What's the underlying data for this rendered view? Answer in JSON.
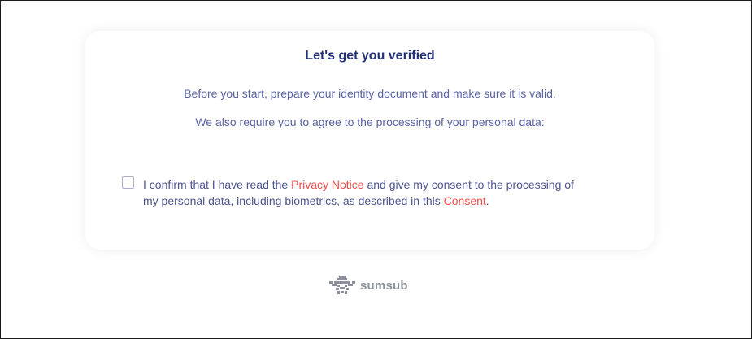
{
  "card": {
    "title": "Let's get you verified",
    "paragraph_1": "Before you start, prepare your identity document and make sure it is valid.",
    "paragraph_2": "We also require you to agree to the processing of your personal data:"
  },
  "consent": {
    "checked": false,
    "text_before_privacy": "I confirm that I have read the ",
    "privacy_link": "Privacy Notice",
    "text_middle": " and give my consent to the processing of my personal data, including biometrics, as described in this ",
    "consent_link": "Consent",
    "text_end": "."
  },
  "brand": {
    "name": "sumsub",
    "icon": "sumsub-logo-icon"
  },
  "colors": {
    "title": "#23307a",
    "body_text": "#5a63a6",
    "link": "#ef4c4c",
    "checkbox_border": "#a6acd2",
    "brand_text": "#8c8f9c"
  }
}
